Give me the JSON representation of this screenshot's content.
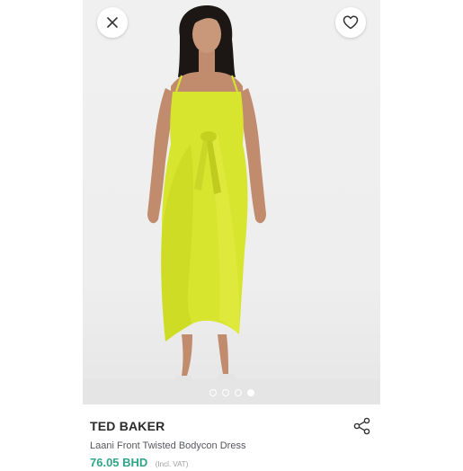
{
  "product": {
    "brand": "TED BAKER",
    "name": "Laani Front Twisted Bodycon Dress",
    "price": "76.05 BHD",
    "vat_note": "(Incl. VAT)",
    "image_count": 4,
    "active_image_index": 3
  },
  "icons": {
    "close": "close-icon",
    "wishlist": "heart-icon",
    "share": "share-icon"
  },
  "colors": {
    "price": "#2fa58a",
    "dress": "#d8e52e",
    "background": "#ececec"
  }
}
